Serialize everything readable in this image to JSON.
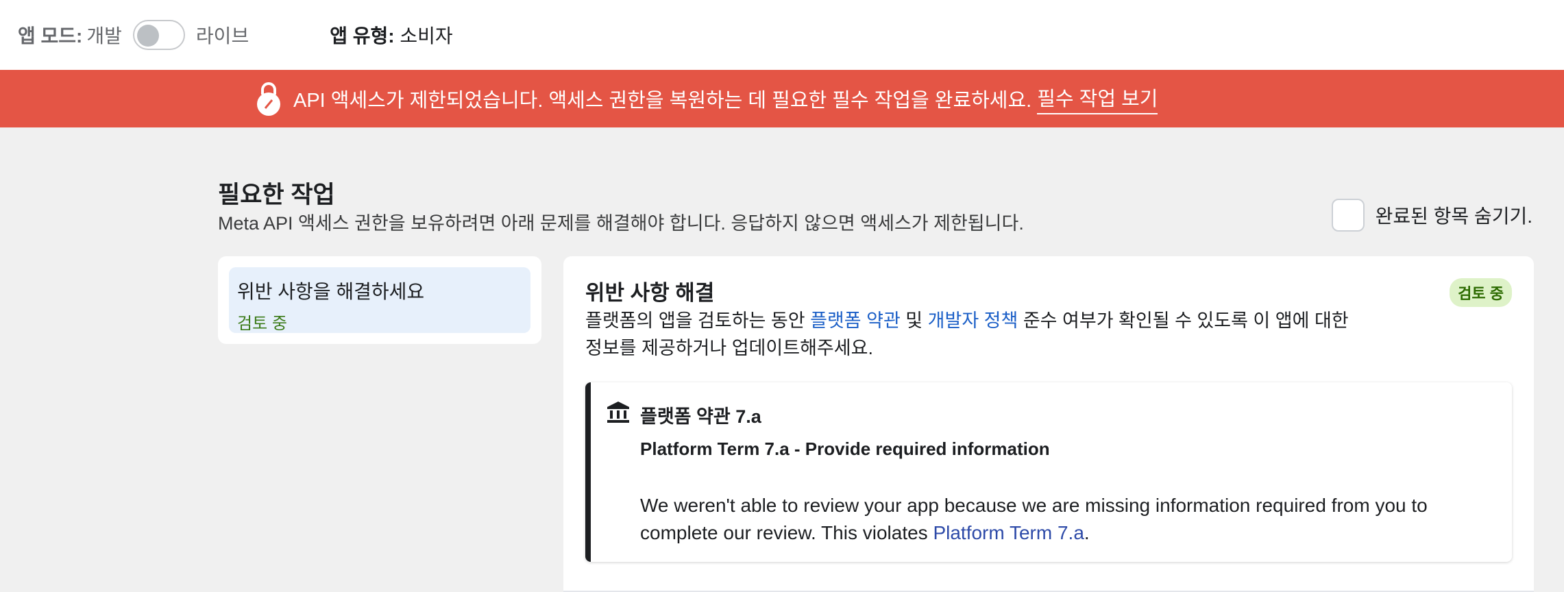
{
  "topbar": {
    "mode_label": "앱 모드:",
    "mode_dev": "개발",
    "mode_live": "라이브",
    "type_label": "앱 유형:",
    "type_value": "소비자"
  },
  "banner": {
    "message": "API 액세스가 제한되었습니다. 액세스 권한을 복원하는 데 필요한 필수 작업을 완료하세요.",
    "link": "필수 작업 보기",
    "color": "#e45545"
  },
  "section": {
    "title": "필요한 작업",
    "description": "Meta API 액세스 권한을 보유하려면 아래 문제를 해결해야 합니다. 응답하지 않으면 액세스가 제한됩니다.",
    "hide_completed_label": "완료된 항목 숨기기."
  },
  "sidebar": {
    "items": [
      {
        "title": "위반 사항을 해결하세요",
        "status": "검토 중"
      }
    ]
  },
  "main": {
    "title": "위반 사항 해결",
    "badge": "검토 중",
    "desc_part1": "플랫폼의 앱을 검토하는 동안 ",
    "desc_link1": "플랫폼 약관",
    "desc_part2": " 및 ",
    "desc_link2": "개발자 정책",
    "desc_part3": " 준수 여부가 확인될 수 있도록 이 앱에 대한 정보를 제공하거나 업데이트해주세요.",
    "violation": {
      "icon": "bank-icon",
      "heading": "플랫폼 약관 7.a",
      "subheading": "Platform Term 7.a - Provide required information",
      "body": "We weren't able to review your app because we are missing information required from you to complete our review. This violates ",
      "body_link": "Platform Term 7.a",
      "body_end": "."
    }
  }
}
